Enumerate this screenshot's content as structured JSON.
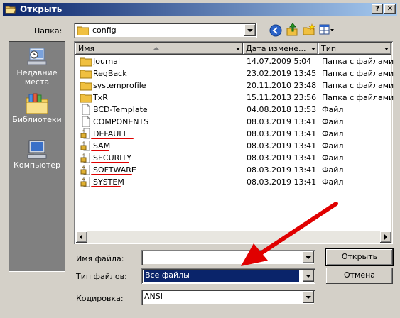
{
  "window": {
    "title": "Открыть",
    "help_label": "?",
    "close_label": "✕"
  },
  "toolbar": {
    "folder_label": "Папка:",
    "folder_value": "config"
  },
  "places": [
    {
      "label": "Недавние места",
      "icon": "recent-places-icon"
    },
    {
      "label": "Библиотеки",
      "icon": "libraries-icon"
    },
    {
      "label": "Компьютер",
      "icon": "computer-icon"
    }
  ],
  "columns": {
    "name": "Имя",
    "date": "Дата измене...",
    "type": "Тип"
  },
  "files": [
    {
      "name": "Journal",
      "date": "14.07.2009 5:04",
      "type": "Папка с файлами",
      "kind": "folder"
    },
    {
      "name": "RegBack",
      "date": "23.02.2019 13:45",
      "type": "Папка с файлами",
      "kind": "folder"
    },
    {
      "name": "systemprofile",
      "date": "20.11.2010 23:48",
      "type": "Папка с файлами",
      "kind": "folder"
    },
    {
      "name": "TxR",
      "date": "15.11.2013 23:56",
      "type": "Папка с файлами",
      "kind": "folder"
    },
    {
      "name": "BCD-Template",
      "date": "04.08.2018 13:53",
      "type": "Файл",
      "kind": "file"
    },
    {
      "name": "COMPONENTS",
      "date": "08.03.2019 13:41",
      "type": "Файл",
      "kind": "file"
    },
    {
      "name": "DEFAULT",
      "date": "08.03.2019 13:41",
      "type": "Файл",
      "kind": "locked"
    },
    {
      "name": "SAM",
      "date": "08.03.2019 13:41",
      "type": "Файл",
      "kind": "locked"
    },
    {
      "name": "SECURITY",
      "date": "08.03.2019 13:41",
      "type": "Файл",
      "kind": "locked"
    },
    {
      "name": "SOFTWARE",
      "date": "08.03.2019 13:41",
      "type": "Файл",
      "kind": "locked"
    },
    {
      "name": "SYSTEM",
      "date": "08.03.2019 13:41",
      "type": "Файл",
      "kind": "locked"
    }
  ],
  "form": {
    "filename_label": "Имя файла:",
    "filename_value": "",
    "filetype_label": "Тип файлов:",
    "filetype_value": "Все файлы",
    "encoding_label": "Кодировка:",
    "encoding_value": "ANSI"
  },
  "buttons": {
    "open": "Открыть",
    "cancel": "Отмена"
  },
  "colors": {
    "title_start": "#0a246a",
    "title_end": "#a6caf0",
    "selection": "#0a246a",
    "annotation": "#e00000",
    "folder": "#f0c040"
  }
}
